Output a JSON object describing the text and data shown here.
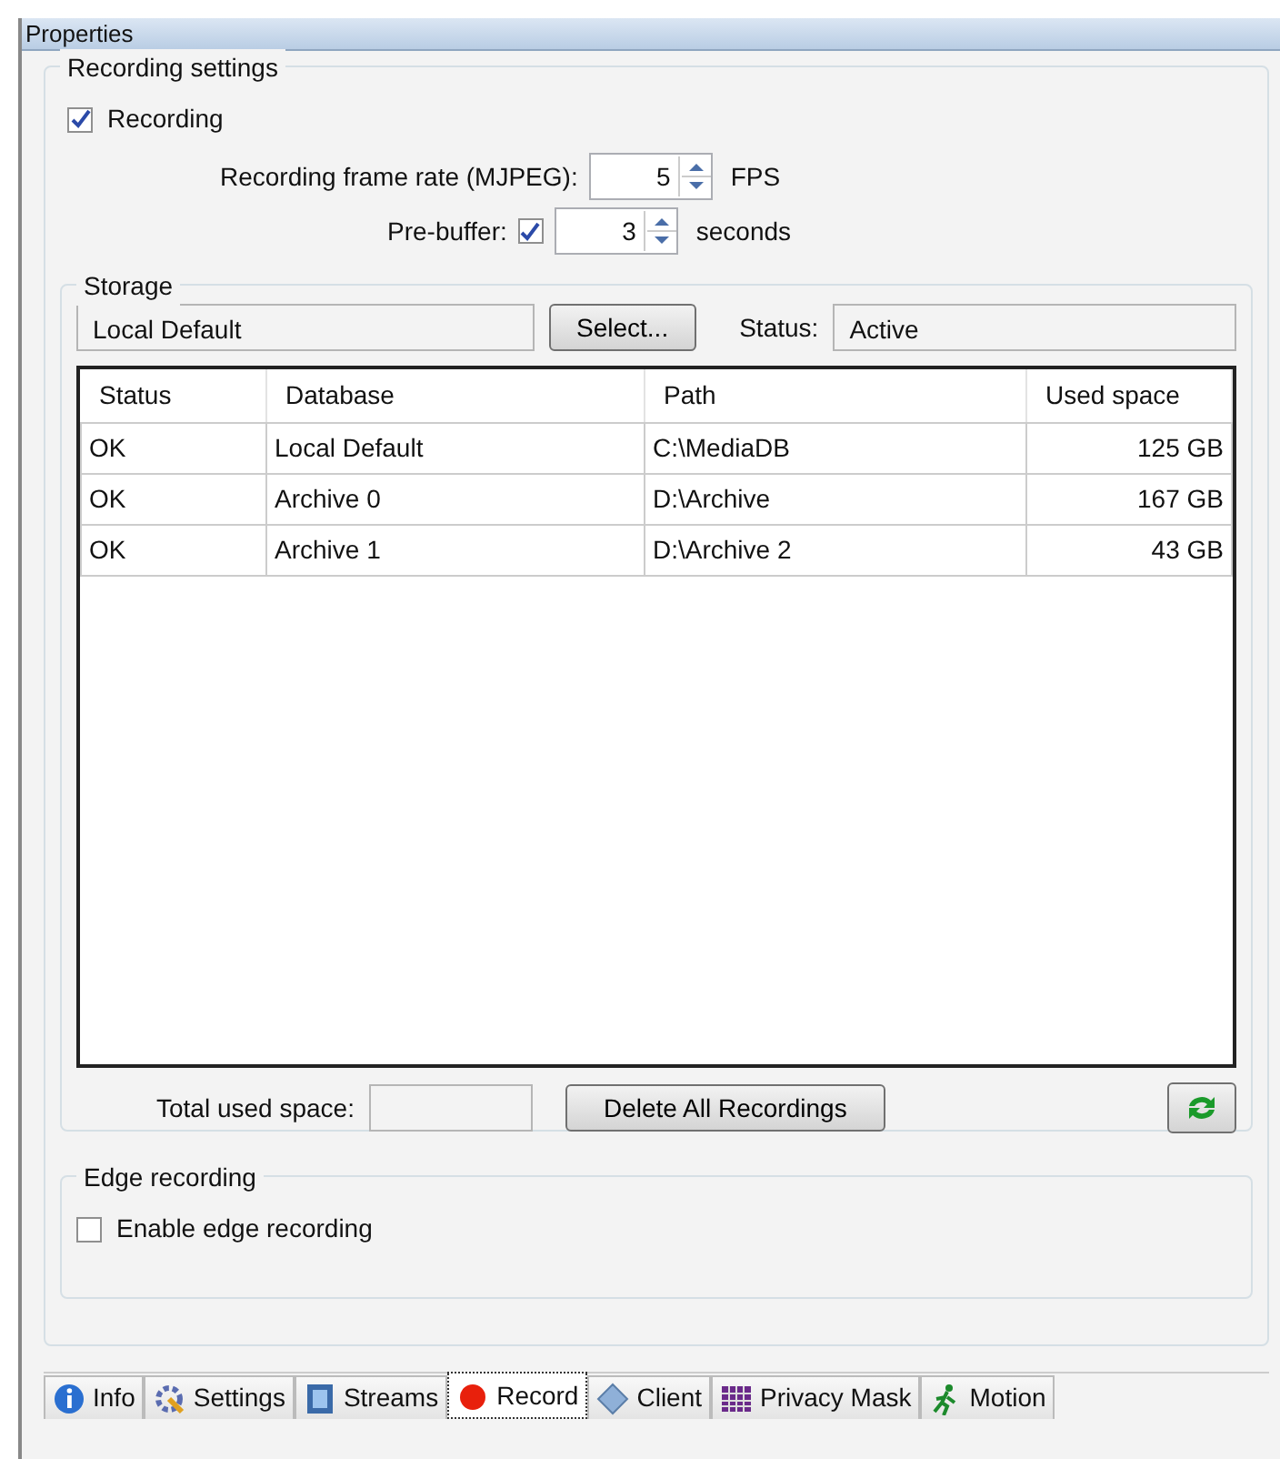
{
  "window": {
    "title": "Properties"
  },
  "recording_settings": {
    "title": "Recording settings",
    "recording": {
      "label": "Recording",
      "checked": true
    },
    "frame_rate": {
      "label": "Recording frame rate (MJPEG):",
      "value": "5",
      "unit": "FPS"
    },
    "pre_buffer": {
      "label": "Pre-buffer:",
      "checked": true,
      "value": "3",
      "unit": "seconds"
    }
  },
  "storage": {
    "title": "Storage",
    "selected_storage": "Local Default",
    "select_button": "Select...",
    "status_label": "Status:",
    "status_value": "Active",
    "table": {
      "columns": [
        "Status",
        "Database",
        "Path",
        "Used space"
      ],
      "rows": [
        [
          "OK",
          "Local Default",
          "C:\\MediaDB",
          "125 GB"
        ],
        [
          "OK",
          "Archive 0",
          "D:\\Archive",
          "167 GB"
        ],
        [
          "OK",
          "Archive 1",
          "D:\\Archive 2",
          "43 GB"
        ]
      ]
    },
    "total_label": "Total used space:",
    "delete_button": "Delete All Recordings"
  },
  "edge_recording": {
    "title": "Edge recording",
    "enable": {
      "label": "Enable edge recording",
      "checked": false
    }
  },
  "tabs": [
    {
      "label": "Info",
      "selected": false
    },
    {
      "label": "Settings",
      "selected": false
    },
    {
      "label": "Streams",
      "selected": false
    },
    {
      "label": "Record",
      "selected": true
    },
    {
      "label": "Client",
      "selected": false
    },
    {
      "label": "Privacy Mask",
      "selected": false
    },
    {
      "label": "Motion",
      "selected": false
    }
  ]
}
